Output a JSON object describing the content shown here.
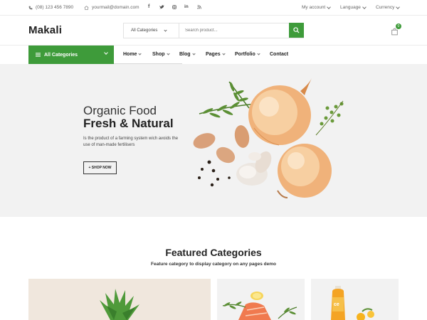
{
  "topbar": {
    "phone": "(08) 123 456 7890",
    "email": "yourmail@domain.com",
    "social": [
      "f",
      "t",
      "ig",
      "in",
      "rss"
    ],
    "my_account": "My account",
    "language": "Language",
    "currency": "Currency"
  },
  "header": {
    "logo": "Makali",
    "category_select": "All Categories",
    "search_placeholder": "Search product...",
    "cart_count": "0"
  },
  "nav": {
    "all_categories": "All Categories",
    "items": [
      "Home",
      "Shop",
      "Blog",
      "Pages",
      "Portfolio",
      "Contact"
    ]
  },
  "hero": {
    "subtitle": "Organic Food",
    "title": "Fresh & Natural",
    "description": "Is the product of a farming system wich avoids the use of man-made fertilisers",
    "button": "+ SHOP NOW"
  },
  "featured": {
    "title": "Featured Categories",
    "subtitle": "Feature category to display category on any pages demo"
  },
  "colors": {
    "accent": "#3e9b3a",
    "hero_bg": "#f2f2f2"
  }
}
